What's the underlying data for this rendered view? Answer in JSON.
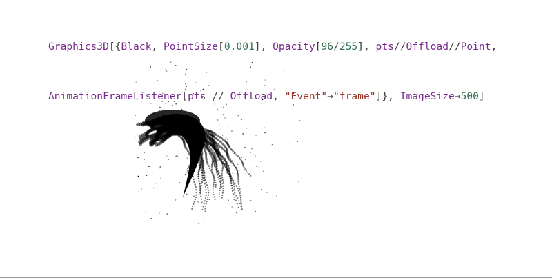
{
  "code": {
    "line1": [
      {
        "t": "Graphics3D",
        "k": "fn"
      },
      {
        "t": "[{",
        "k": "punct"
      },
      {
        "t": "Black",
        "k": "sym"
      },
      {
        "t": ", ",
        "k": "punct"
      },
      {
        "t": "PointSize",
        "k": "fn"
      },
      {
        "t": "[",
        "k": "punct"
      },
      {
        "t": "0.001",
        "k": "num"
      },
      {
        "t": "], ",
        "k": "punct"
      },
      {
        "t": "Opacity",
        "k": "fn"
      },
      {
        "t": "[",
        "k": "punct"
      },
      {
        "t": "96",
        "k": "num"
      },
      {
        "t": "/",
        "k": "punct"
      },
      {
        "t": "255",
        "k": "num"
      },
      {
        "t": "], ",
        "k": "punct"
      },
      {
        "t": "pts",
        "k": "sym"
      },
      {
        "t": "//",
        "k": "punct"
      },
      {
        "t": "Offload",
        "k": "fn"
      },
      {
        "t": "//",
        "k": "punct"
      },
      {
        "t": "Point",
        "k": "fn"
      },
      {
        "t": ",",
        "k": "punct"
      }
    ],
    "line2": [
      {
        "t": "AnimationFrameListener",
        "k": "fn"
      },
      {
        "t": "[",
        "k": "punct"
      },
      {
        "t": "pts",
        "k": "sym"
      },
      {
        "t": " // ",
        "k": "punct"
      },
      {
        "t": "Offload",
        "k": "fn"
      },
      {
        "t": ", ",
        "k": "punct"
      },
      {
        "t": "\"Event\"",
        "k": "str"
      },
      {
        "t": "→",
        "k": "punct"
      },
      {
        "t": "\"frame\"",
        "k": "str"
      },
      {
        "t": "]}, ",
        "k": "punct"
      },
      {
        "t": "ImageSize",
        "k": "fn"
      },
      {
        "t": "→",
        "k": "punct"
      },
      {
        "t": "500",
        "k": "num"
      },
      {
        "t": "]",
        "k": "punct"
      }
    ]
  },
  "output": {
    "point_color": "#000000"
  }
}
